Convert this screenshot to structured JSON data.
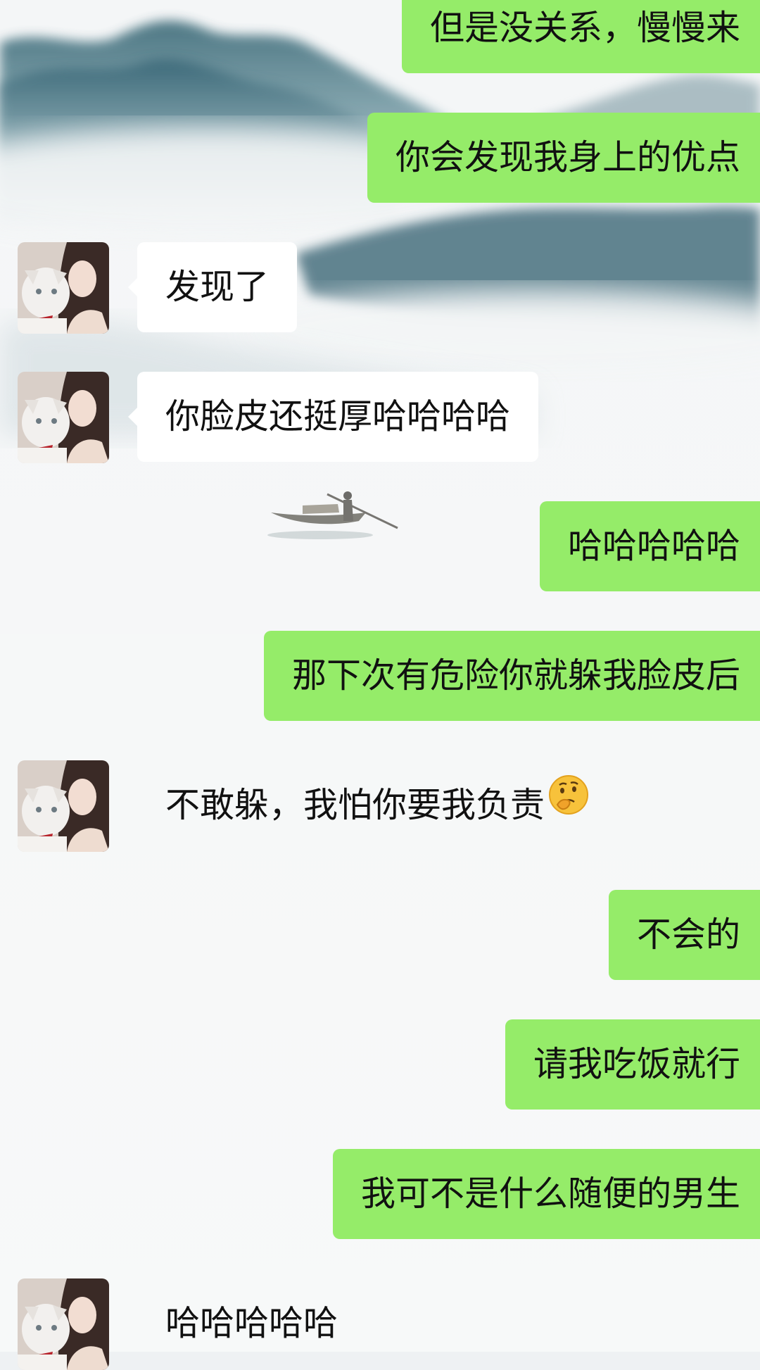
{
  "chat": {
    "messages": [
      {
        "side": "sent",
        "text": "但是没关系，慢慢来"
      },
      {
        "side": "sent",
        "text": "你会发现我身上的优点"
      },
      {
        "side": "recv",
        "avatar": "avatar-girl-with-white-cat",
        "text": "发现了"
      },
      {
        "side": "recv",
        "avatar": "avatar-girl-with-white-cat",
        "text": "你脸皮还挺厚哈哈哈哈"
      },
      {
        "side": "sent",
        "text": "哈哈哈哈哈"
      },
      {
        "side": "sent",
        "text": "那下次有危险你就躲我脸皮后"
      },
      {
        "side": "recv",
        "avatar": "avatar-girl-with-white-cat",
        "text": "不敢躲，我怕你要我负责",
        "emoji": "thinking-face-icon"
      },
      {
        "side": "sent",
        "text": "不会的"
      },
      {
        "side": "sent",
        "text": "请我吃饭就行"
      },
      {
        "side": "sent",
        "text": "我可不是什么随便的男生"
      },
      {
        "side": "recv",
        "avatar": "avatar-girl-with-white-cat",
        "text": "哈哈哈哈哈"
      }
    ]
  },
  "colors": {
    "sent_bubble": "#95ec69",
    "recv_bubble": "#ffffff"
  },
  "background": "ink-wash-mountains-and-boat"
}
